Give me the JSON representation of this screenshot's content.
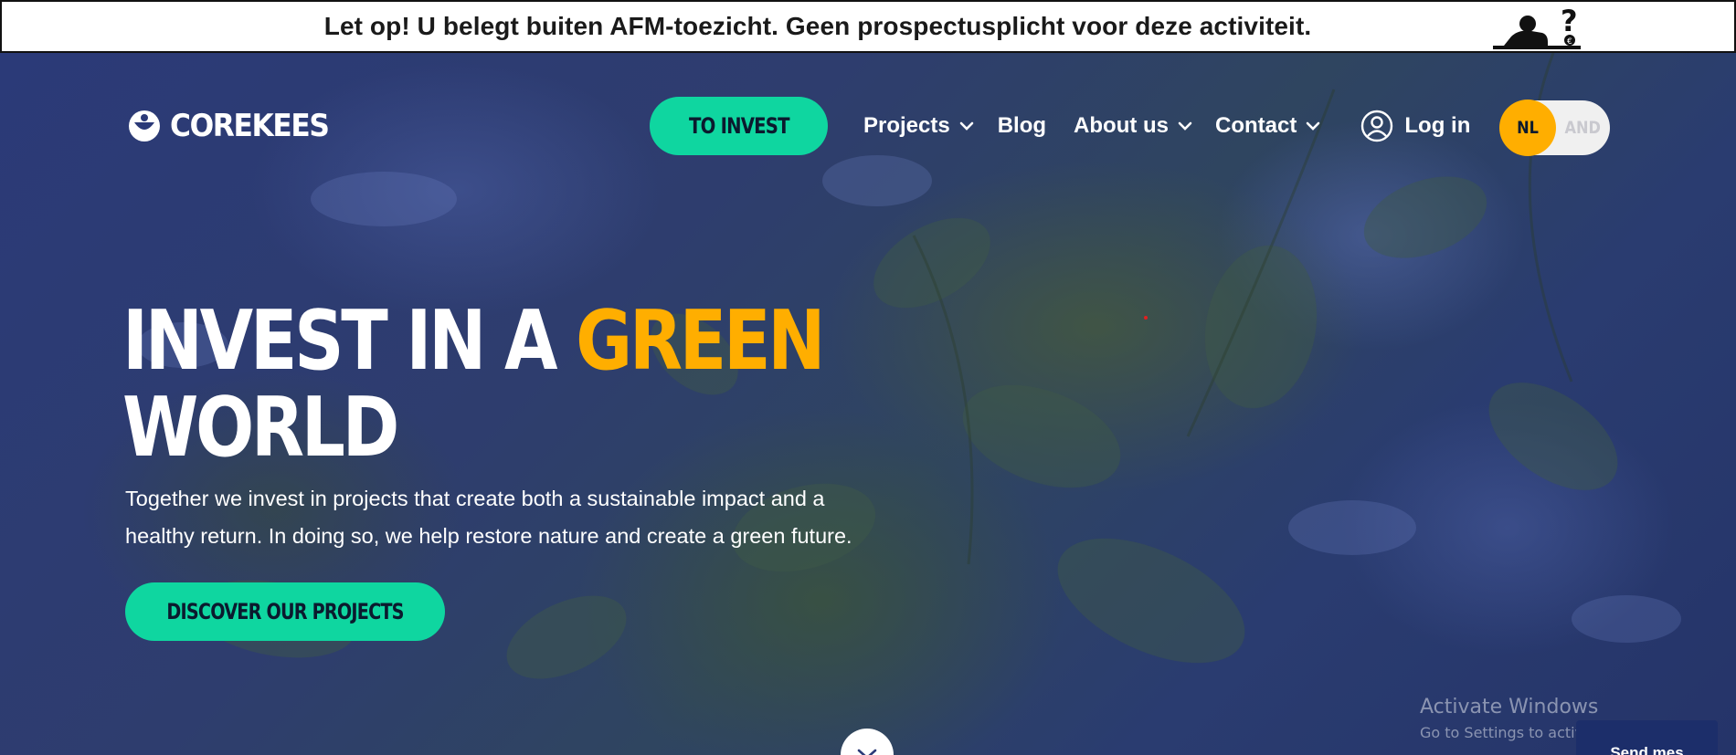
{
  "banner": {
    "warning_text": "Let op! U belegt buiten AFM-toezicht. Geen prospectusplicht voor deze activiteit.",
    "icon": "afm-warning-pictogram"
  },
  "nav": {
    "logo_text": "COREKEES",
    "invest_button": "TO INVEST",
    "items": [
      {
        "label": "Projects",
        "has_dropdown": true
      },
      {
        "label": "Blog",
        "has_dropdown": false
      },
      {
        "label": "About us",
        "has_dropdown": true
      },
      {
        "label": "Contact",
        "has_dropdown": true
      }
    ],
    "login_label": "Log in",
    "lang_active": "NL",
    "lang_inactive": "AND"
  },
  "hero": {
    "headline_part1": "INVEST IN A ",
    "headline_accent": "GREEN",
    "headline_part2": "WORLD",
    "subtext": "Together we invest in projects that create both a sustainable impact and a healthy return. In doing so, we help restore nature and create a green future.",
    "cta": "DISCOVER OUR PROJECTS"
  },
  "watermark": {
    "title": "Activate Windows",
    "subtitle": "Go to Settings to activate Windows."
  },
  "chat": {
    "label": "Send mes"
  },
  "colors": {
    "accent_green": "#0fd6a0",
    "accent_yellow": "#ffae00",
    "hero_overlay": "#2b3a78"
  }
}
